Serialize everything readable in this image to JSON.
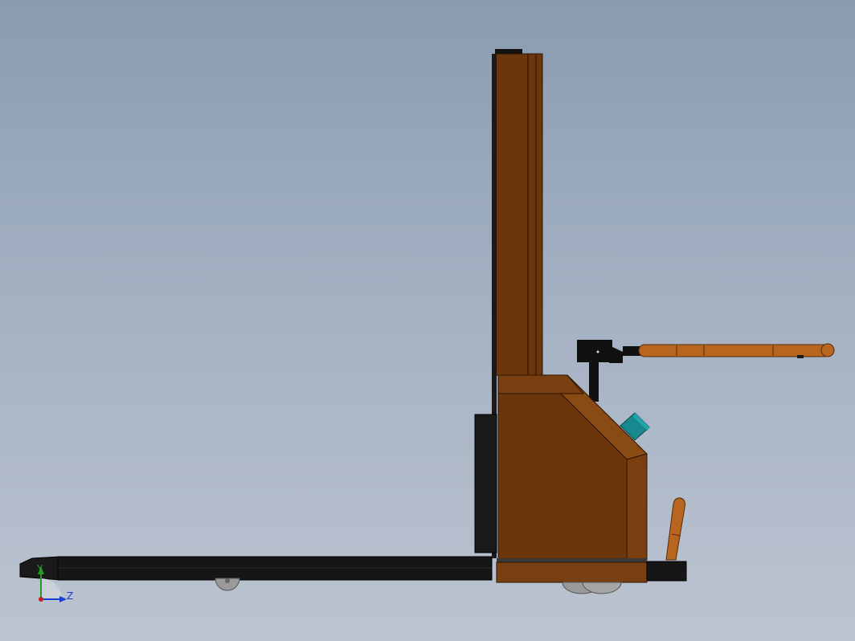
{
  "viewport": {
    "background_top": "#8a9bb0",
    "background_bottom": "#bcc4d0"
  },
  "model": {
    "body_color": "#6b360b",
    "body_highlight": "#8a4a14",
    "handle_color": "#b8651f",
    "black_parts": "#1a1a1a",
    "control_color": "#17898f",
    "wheel_color": "#9a9a9a"
  },
  "triad": {
    "y_label": "Y",
    "z_label": "Z",
    "y_color": "#1fa01f",
    "z_color": "#1a3fcf",
    "origin_color": "#c81e1e"
  }
}
